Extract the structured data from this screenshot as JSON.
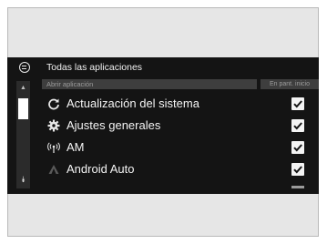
{
  "header": {
    "title": "Todas las aplicaciones",
    "back_icon": "menu-circle-icon"
  },
  "columns": {
    "app": "Abrir aplicación",
    "screen": "En pant. inicio"
  },
  "items": [
    {
      "label": "Actualización del sistema",
      "icon": "refresh-icon",
      "checked": true
    },
    {
      "label": "Ajustes generales",
      "icon": "gear-icon",
      "checked": true
    },
    {
      "label": "AM",
      "icon": "radio-antenna-icon",
      "checked": true
    },
    {
      "label": "Android Auto",
      "icon": "android-auto-icon",
      "checked": true
    }
  ],
  "scrollbar": {
    "up_icon": "scroll-up-icon",
    "down_icon": "scroll-down-icon"
  },
  "colors": {
    "screen_bg": "#141414",
    "text": "#f4f4f4",
    "header_bar": "#3e3e3e"
  }
}
